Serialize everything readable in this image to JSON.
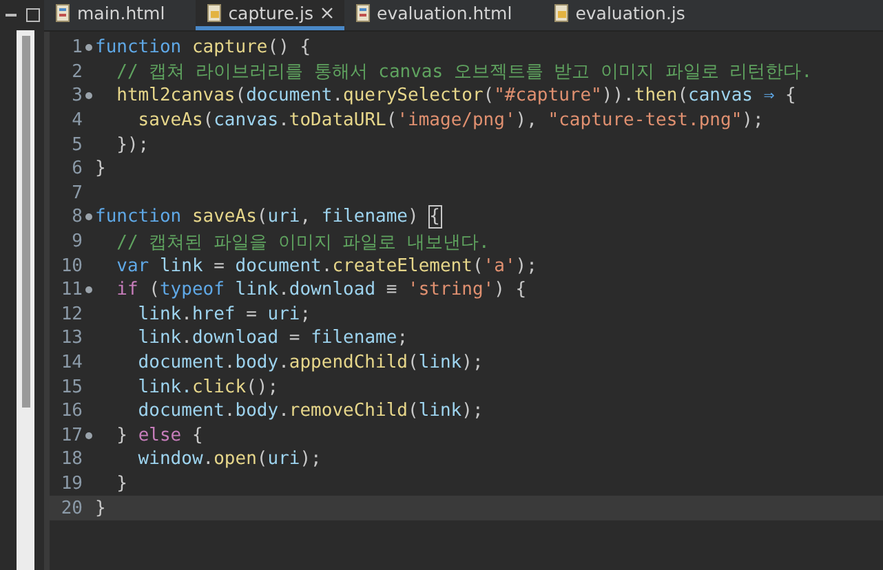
{
  "tabs": [
    {
      "label": "main.html",
      "kind": "html",
      "selected": false,
      "closable": false
    },
    {
      "label": "capture.js",
      "kind": "js",
      "selected": true,
      "closable": true
    },
    {
      "label": "evaluation.html",
      "kind": "html",
      "selected": false,
      "closable": false
    },
    {
      "label": "evaluation.js",
      "kind": "js",
      "selected": false,
      "closable": false
    }
  ],
  "lines": [
    {
      "number": "1",
      "fold": true,
      "current": false,
      "tokens": [
        {
          "kind": "kw",
          "t": "function "
        },
        {
          "kind": "fn",
          "t": "capture"
        },
        {
          "kind": "p",
          "t": "() {"
        }
      ]
    },
    {
      "number": "2",
      "fold": false,
      "current": false,
      "tokens": [
        {
          "kind": "cm",
          "t": "  // 캡쳐 라이브러리를 통해서 canvas 오브젝트를 받고 이미지 파일로 리턴한다."
        }
      ]
    },
    {
      "number": "3",
      "fold": true,
      "current": false,
      "tokens": [
        {
          "kind": "fn",
          "t": "  html2canvas"
        },
        {
          "kind": "p",
          "t": "("
        },
        {
          "kind": "v",
          "t": "document"
        },
        {
          "kind": "p",
          "t": "."
        },
        {
          "kind": "fn",
          "t": "querySelector"
        },
        {
          "kind": "p",
          "t": "("
        },
        {
          "kind": "s",
          "t": "\"#capture\""
        },
        {
          "kind": "p",
          "t": "))."
        },
        {
          "kind": "fn",
          "t": "then"
        },
        {
          "kind": "p",
          "t": "("
        },
        {
          "kind": "v",
          "t": "canvas "
        },
        {
          "kind": "kw",
          "t": "⇒"
        },
        {
          "kind": "p",
          "t": " {"
        }
      ]
    },
    {
      "number": "4",
      "fold": false,
      "current": false,
      "tokens": [
        {
          "kind": "fn",
          "t": "    saveAs"
        },
        {
          "kind": "p",
          "t": "("
        },
        {
          "kind": "v",
          "t": "canvas"
        },
        {
          "kind": "p",
          "t": "."
        },
        {
          "kind": "fn",
          "t": "toDataURL"
        },
        {
          "kind": "p",
          "t": "("
        },
        {
          "kind": "s",
          "t": "'image/png'"
        },
        {
          "kind": "p",
          "t": "), "
        },
        {
          "kind": "s",
          "t": "\"capture-test.png\""
        },
        {
          "kind": "p",
          "t": ");"
        }
      ]
    },
    {
      "number": "5",
      "fold": false,
      "current": false,
      "tokens": [
        {
          "kind": "p",
          "t": "  });"
        }
      ]
    },
    {
      "number": "6",
      "fold": false,
      "current": false,
      "tokens": [
        {
          "kind": "p",
          "t": "}"
        }
      ]
    },
    {
      "number": "7",
      "fold": false,
      "current": false
    },
    {
      "number": "8",
      "fold": true,
      "current": false,
      "tokens": [
        {
          "kind": "kw",
          "t": "function "
        },
        {
          "kind": "fn",
          "t": "saveAs"
        },
        {
          "kind": "p",
          "t": "("
        },
        {
          "kind": "v",
          "t": "uri"
        },
        {
          "kind": "p",
          "t": ", "
        },
        {
          "kind": "v",
          "t": "filename"
        },
        {
          "kind": "p",
          "t": ") "
        },
        {
          "kind": "match",
          "t": "{"
        }
      ]
    },
    {
      "number": "9",
      "fold": false,
      "current": false,
      "tokens": [
        {
          "kind": "cm",
          "t": "  // 캡쳐된 파일을 이미지 파일로 내보낸다."
        }
      ]
    },
    {
      "number": "10",
      "fold": false,
      "current": false,
      "tokens": [
        {
          "kind": "kw",
          "t": "  var "
        },
        {
          "kind": "v",
          "t": "link"
        },
        {
          "kind": "p",
          "t": " = "
        },
        {
          "kind": "v",
          "t": "document"
        },
        {
          "kind": "p",
          "t": "."
        },
        {
          "kind": "fn",
          "t": "createElement"
        },
        {
          "kind": "p",
          "t": "("
        },
        {
          "kind": "s",
          "t": "'a'"
        },
        {
          "kind": "p",
          "t": ");"
        }
      ]
    },
    {
      "number": "11",
      "fold": true,
      "current": false,
      "tokens": [
        {
          "kind": "ctl",
          "t": "  if"
        },
        {
          "kind": "p",
          "t": " ("
        },
        {
          "kind": "kw",
          "t": "typeof "
        },
        {
          "kind": "v",
          "t": "link"
        },
        {
          "kind": "p",
          "t": "."
        },
        {
          "kind": "v",
          "t": "download"
        },
        {
          "kind": "p",
          "t": " ≡ "
        },
        {
          "kind": "s",
          "t": "'string'"
        },
        {
          "kind": "p",
          "t": ") {"
        }
      ]
    },
    {
      "number": "12",
      "fold": false,
      "current": false,
      "tokens": [
        {
          "kind": "v",
          "t": "    link"
        },
        {
          "kind": "p",
          "t": "."
        },
        {
          "kind": "v",
          "t": "href"
        },
        {
          "kind": "p",
          "t": " = "
        },
        {
          "kind": "v",
          "t": "uri"
        },
        {
          "kind": "p",
          "t": ";"
        }
      ]
    },
    {
      "number": "13",
      "fold": false,
      "current": false,
      "tokens": [
        {
          "kind": "v",
          "t": "    link"
        },
        {
          "kind": "p",
          "t": "."
        },
        {
          "kind": "v",
          "t": "download"
        },
        {
          "kind": "p",
          "t": " = "
        },
        {
          "kind": "v",
          "t": "filename"
        },
        {
          "kind": "p",
          "t": ";"
        }
      ]
    },
    {
      "number": "14",
      "fold": false,
      "current": false,
      "tokens": [
        {
          "kind": "v",
          "t": "    document"
        },
        {
          "kind": "p",
          "t": "."
        },
        {
          "kind": "v",
          "t": "body"
        },
        {
          "kind": "p",
          "t": "."
        },
        {
          "kind": "fn",
          "t": "appendChild"
        },
        {
          "kind": "p",
          "t": "("
        },
        {
          "kind": "v",
          "t": "link"
        },
        {
          "kind": "p",
          "t": ");"
        }
      ]
    },
    {
      "number": "15",
      "fold": false,
      "current": false,
      "tokens": [
        {
          "kind": "v",
          "t": "    link."
        },
        {
          "kind": "fn",
          "t": "click"
        },
        {
          "kind": "p",
          "t": "();"
        }
      ]
    },
    {
      "number": "16",
      "fold": false,
      "current": false,
      "tokens": [
        {
          "kind": "v",
          "t": "    document"
        },
        {
          "kind": "p",
          "t": "."
        },
        {
          "kind": "v",
          "t": "body"
        },
        {
          "kind": "p",
          "t": "."
        },
        {
          "kind": "fn",
          "t": "removeChild"
        },
        {
          "kind": "p",
          "t": "("
        },
        {
          "kind": "v",
          "t": "link"
        },
        {
          "kind": "p",
          "t": ");"
        }
      ]
    },
    {
      "number": "17",
      "fold": true,
      "current": false,
      "tokens": [
        {
          "kind": "p",
          "t": "  } "
        },
        {
          "kind": "ctl",
          "t": "else"
        },
        {
          "kind": "p",
          "t": " {"
        }
      ]
    },
    {
      "number": "18",
      "fold": false,
      "current": false,
      "tokens": [
        {
          "kind": "v",
          "t": "    window"
        },
        {
          "kind": "p",
          "t": "."
        },
        {
          "kind": "fn",
          "t": "open"
        },
        {
          "kind": "p",
          "t": "("
        },
        {
          "kind": "v",
          "t": "uri"
        },
        {
          "kind": "p",
          "t": ");"
        }
      ]
    },
    {
      "number": "19",
      "fold": false,
      "current": false,
      "tokens": [
        {
          "kind": "p",
          "t": "  }"
        }
      ]
    },
    {
      "number": "20",
      "fold": false,
      "current": true,
      "tokens": [
        {
          "kind": "p",
          "t": "}"
        }
      ]
    }
  ]
}
